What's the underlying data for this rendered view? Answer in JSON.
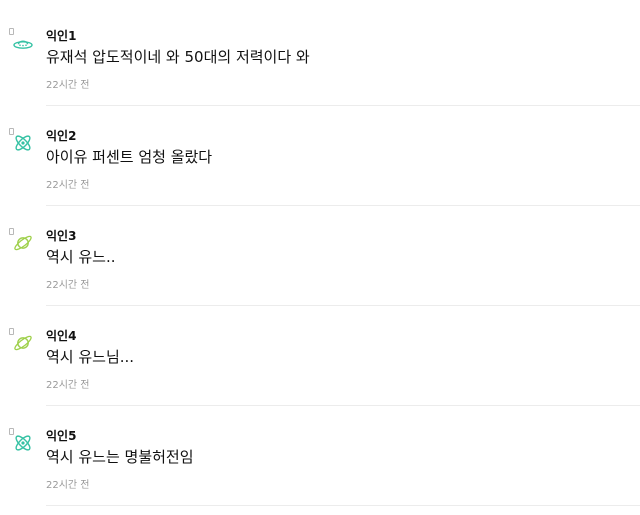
{
  "comments": [
    {
      "nickname": "익인1",
      "text": "유재석 압도적이네 와 50대의 저력이다 와",
      "time": "22시간 전",
      "icon": "ufo-icon",
      "icon_color": "#36c2a4"
    },
    {
      "nickname": "익인2",
      "text": "아이유 퍼센트 엄청 올랐다",
      "time": "22시간 전",
      "icon": "atom-icon",
      "icon_color": "#36c2a4"
    },
    {
      "nickname": "익인3",
      "text": "역시 유느..",
      "time": "22시간 전",
      "icon": "planet-icon",
      "icon_color": "#9ed04a"
    },
    {
      "nickname": "익인4",
      "text": "역시 유느님...",
      "time": "22시간 전",
      "icon": "planet-icon",
      "icon_color": "#9ed04a"
    },
    {
      "nickname": "익인5",
      "text": "역시 유느는 명불허전임",
      "time": "22시간 전",
      "icon": "atom-icon",
      "icon_color": "#36c2a4"
    }
  ]
}
